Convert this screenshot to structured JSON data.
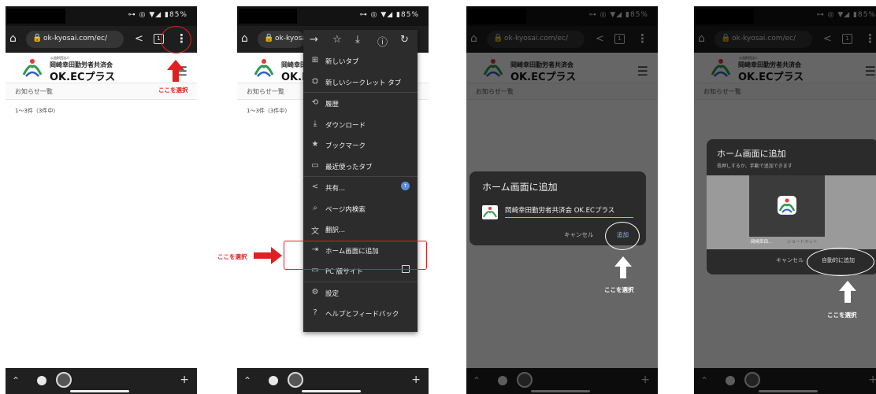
{
  "status": {
    "icons": "⊶ ◎ ▼◢ ▮85%"
  },
  "browser": {
    "url": "ok-kyosai.com/ec/",
    "url_short": "ok-kyosa"
  },
  "site": {
    "small_label": "公益財団法人",
    "org_name": "岡崎幸田勤労者共済会",
    "brand": "OK.ECプラス",
    "notice_label": "お知らせ一覧",
    "count_text": "1～3件（3件中）"
  },
  "menu": {
    "items": [
      {
        "icon": "⊞",
        "label": "新しいタブ"
      },
      {
        "icon": "⛭",
        "label": "新しいシークレット タブ"
      },
      {
        "icon": "⟲",
        "label": "履歴"
      },
      {
        "icon": "⤓",
        "label": "ダウンロード"
      },
      {
        "icon": "★",
        "label": "ブックマーク"
      },
      {
        "icon": "▭",
        "label": "最近使ったタブ"
      },
      {
        "icon": "<",
        "label": "共有..."
      },
      {
        "icon": "⌕",
        "label": "ページ内検索"
      },
      {
        "icon": "文",
        "label": "翻訳..."
      },
      {
        "icon": "⇥",
        "label": "ホーム画面に追加"
      },
      {
        "icon": "▭",
        "label": "PC 版サイト"
      },
      {
        "icon": "⚙",
        "label": "設定"
      },
      {
        "icon": "?",
        "label": "ヘルプとフィードバック"
      }
    ]
  },
  "dialog1": {
    "title": "ホーム画面に追加",
    "name_value": "岡崎幸田勤労者共済会 OK.ECプラス",
    "cancel": "キャンセル",
    "add": "追加"
  },
  "dialog2": {
    "title": "ホーム画面に追加",
    "subtitle": "長押しするか、手動で追加できます",
    "app_name": "岡崎幸田...",
    "shortcut": "ショートカット",
    "cancel": "キャンセル",
    "auto_add": "自動的に追加"
  },
  "annotations": {
    "select_here": "ここを選択"
  },
  "colors": {
    "highlight_red": "#e02020",
    "link_blue": "#8fb4e8",
    "menu_bg": "#2c2c2c"
  }
}
